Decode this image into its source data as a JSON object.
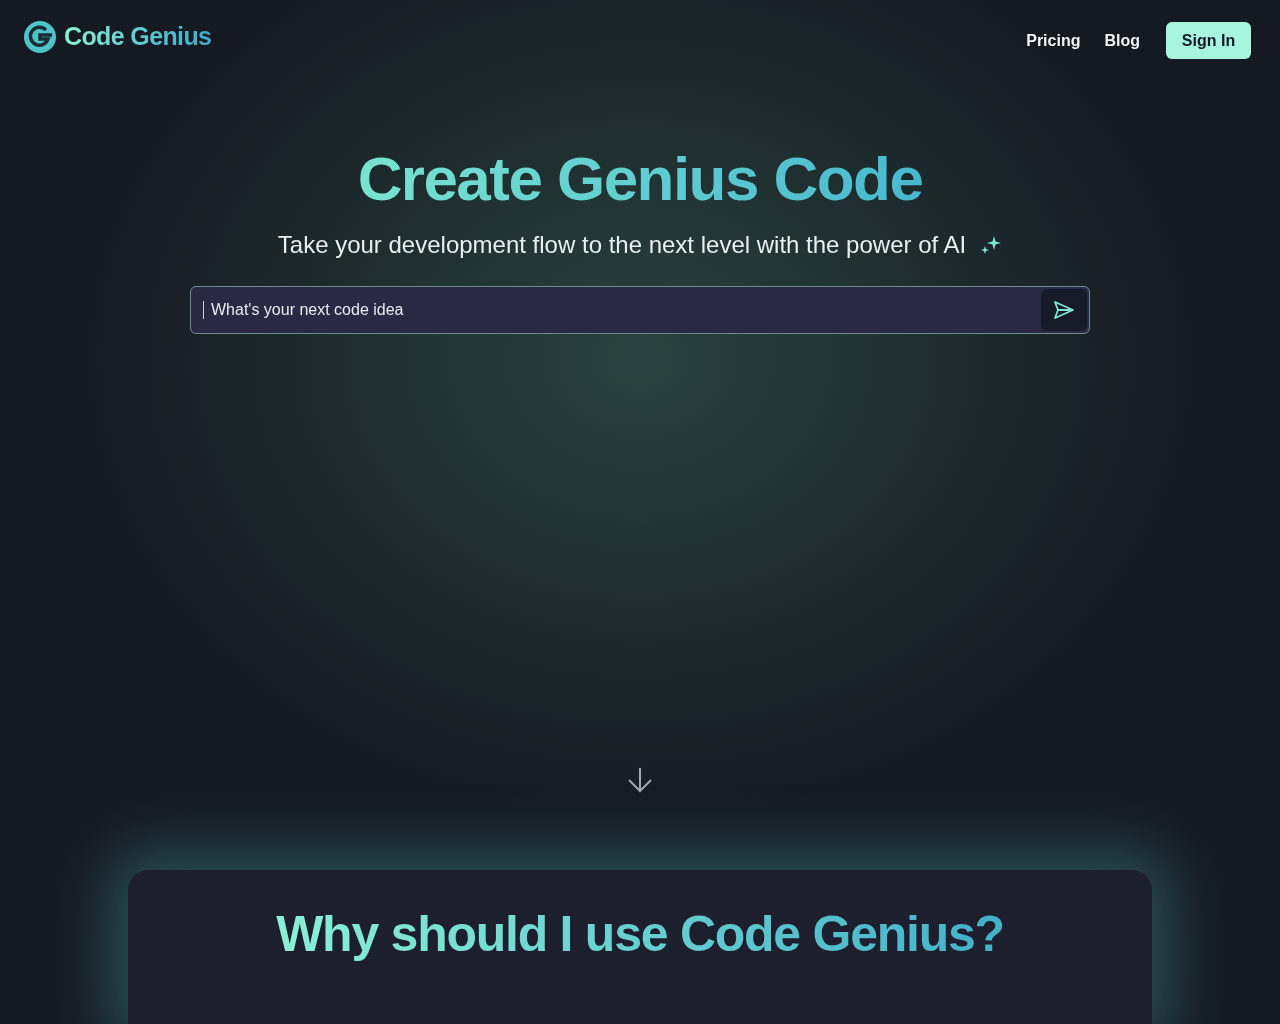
{
  "header": {
    "brand": "Code Genius",
    "nav_links": [
      "Pricing",
      "Blog"
    ],
    "sign_in": "Sign In"
  },
  "hero": {
    "title": "Create Genius Code",
    "subtitle": "Take your development flow to the next level with the power of AI",
    "prompt": {
      "placeholder": "What's your next code idea"
    }
  },
  "features": {
    "title": "Why should I use Code Genius?"
  }
}
